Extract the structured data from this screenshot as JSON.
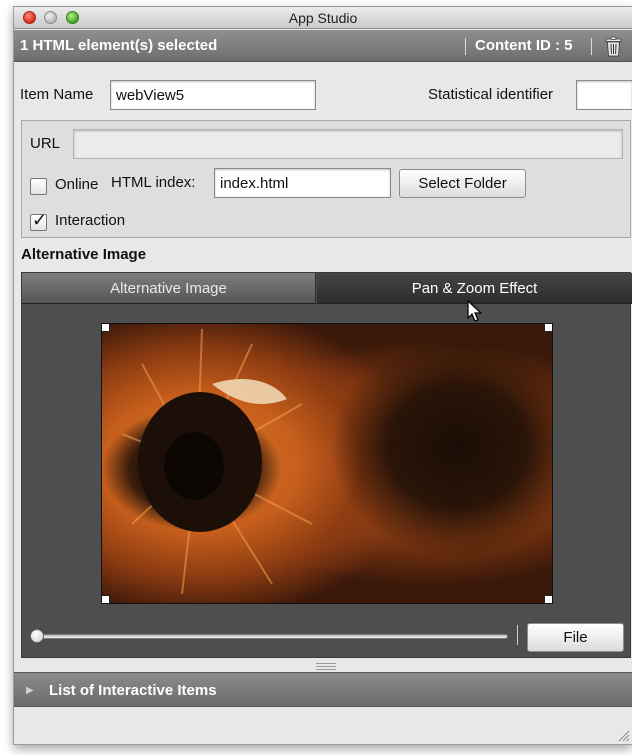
{
  "window": {
    "title": "App Studio"
  },
  "selection_bar": {
    "title": "1 HTML element(s) selected",
    "content_id": "Content ID : 5",
    "trash_icon": "trash-icon"
  },
  "item": {
    "name_label": "Item Name",
    "name_value": "webView5",
    "stat_label": "Statistical identifier",
    "stat_value": ""
  },
  "url_group": {
    "url_label": "URL",
    "url_value": "",
    "online_label": "Online",
    "online_checked": false,
    "html_index_label": "HTML index:",
    "html_index_value": "index.html",
    "select_folder_label": "Select Folder",
    "interaction_label": "Interaction",
    "interaction_checked": true
  },
  "alt_image": {
    "section_title": "Alternative Image",
    "tabs": [
      {
        "label": "Alternative Image",
        "selected": false
      },
      {
        "label": "Pan & Zoom Effect",
        "selected": true
      }
    ],
    "image_subject": "sunflower close-up photo",
    "file_button_label": "File",
    "zoom_slider_value": 0
  },
  "list_section": {
    "label": "List of Interactive Items",
    "expanded": false
  },
  "colors": {
    "selection_bar": "#7e7e7e",
    "panel_bg": "#4e4e4e",
    "window_bg": "#e8e8e8"
  }
}
